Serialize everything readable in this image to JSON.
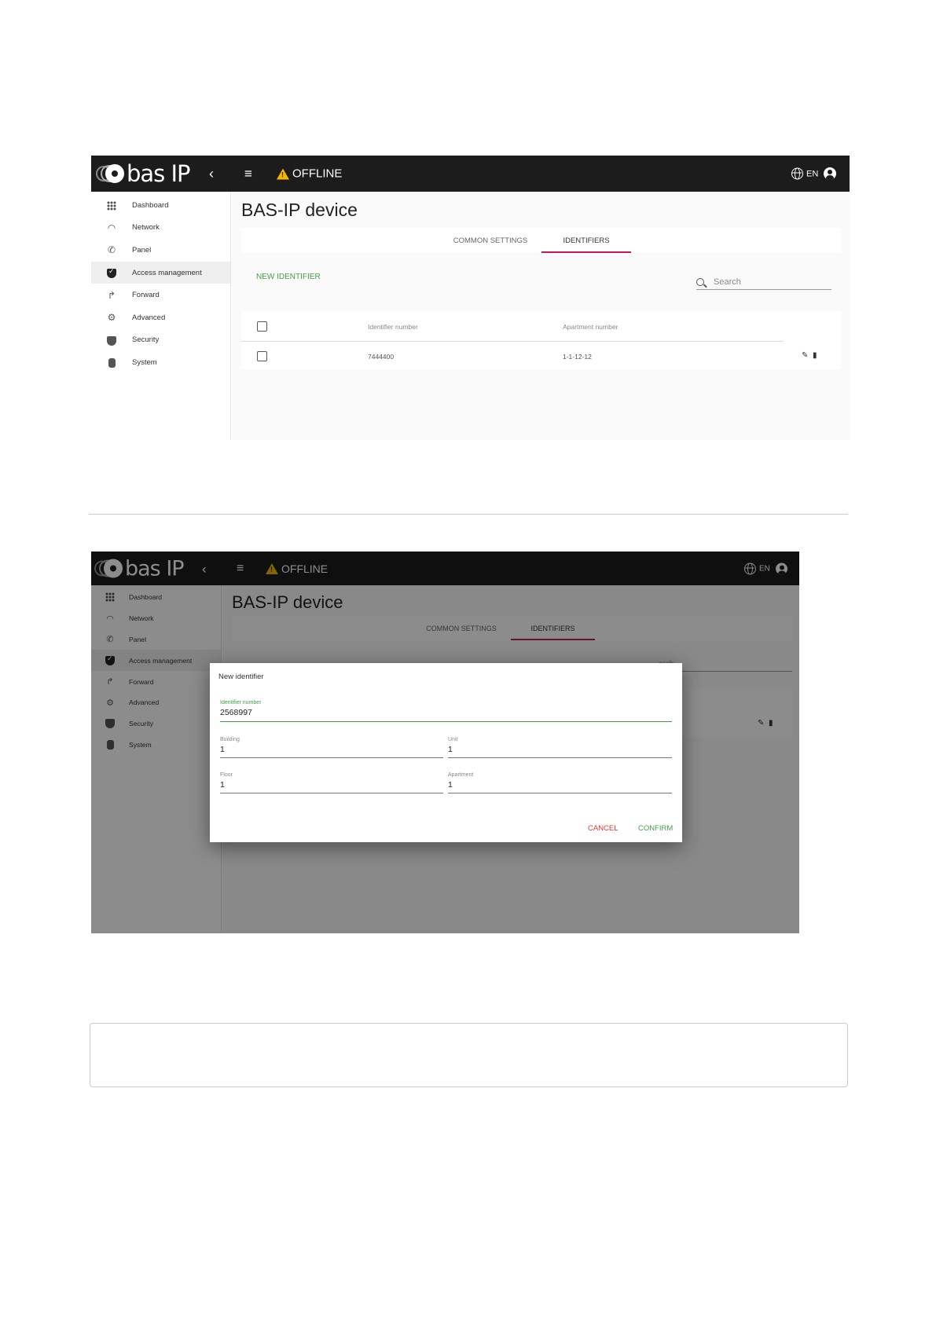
{
  "app": {
    "logo_text": "bas IP",
    "status": "OFFLINE",
    "language": "EN",
    "colors": {
      "topbar": "#1c1c1c",
      "accent_green": "#43a047",
      "tab_underline": "#c2185b",
      "cancel_red": "#e53935",
      "warning": "#f5b400"
    }
  },
  "sidebar": {
    "items": [
      {
        "label": "Dashboard",
        "icon": "grid-icon"
      },
      {
        "label": "Network",
        "icon": "wifi-icon"
      },
      {
        "label": "Panel",
        "icon": "phone-icon"
      },
      {
        "label": "Access management",
        "icon": "shield-check-icon",
        "active": true
      },
      {
        "label": "Forward",
        "icon": "call-forward-icon"
      },
      {
        "label": "Advanced",
        "icon": "gear-icon"
      },
      {
        "label": "Security",
        "icon": "security-icon"
      },
      {
        "label": "System",
        "icon": "system-icon"
      }
    ]
  },
  "page": {
    "title": "BAS-IP device",
    "tabs": [
      {
        "label": "COMMON SETTINGS"
      },
      {
        "label": "IDENTIFIERS",
        "active": true
      }
    ],
    "new_identifier_label": "NEW IDENTIFIER",
    "search_placeholder": "Search"
  },
  "table": {
    "columns": [
      "Identifier number",
      "Apartment number"
    ],
    "rows": [
      {
        "identifier": "7444400",
        "apartment": "1-1-12-12"
      }
    ]
  },
  "dialog": {
    "title": "New identifier",
    "fields": {
      "identifier": {
        "label": "Identifier number",
        "value": "2568997"
      },
      "building": {
        "label": "Building",
        "value": "1"
      },
      "unit": {
        "label": "Unit",
        "value": "1"
      },
      "floor": {
        "label": "Floor",
        "value": "1"
      },
      "apartment": {
        "label": "Apartment",
        "value": "1"
      }
    },
    "cancel_label": "CANCEL",
    "confirm_label": "CONFIRM",
    "search_fragment": "arch"
  }
}
